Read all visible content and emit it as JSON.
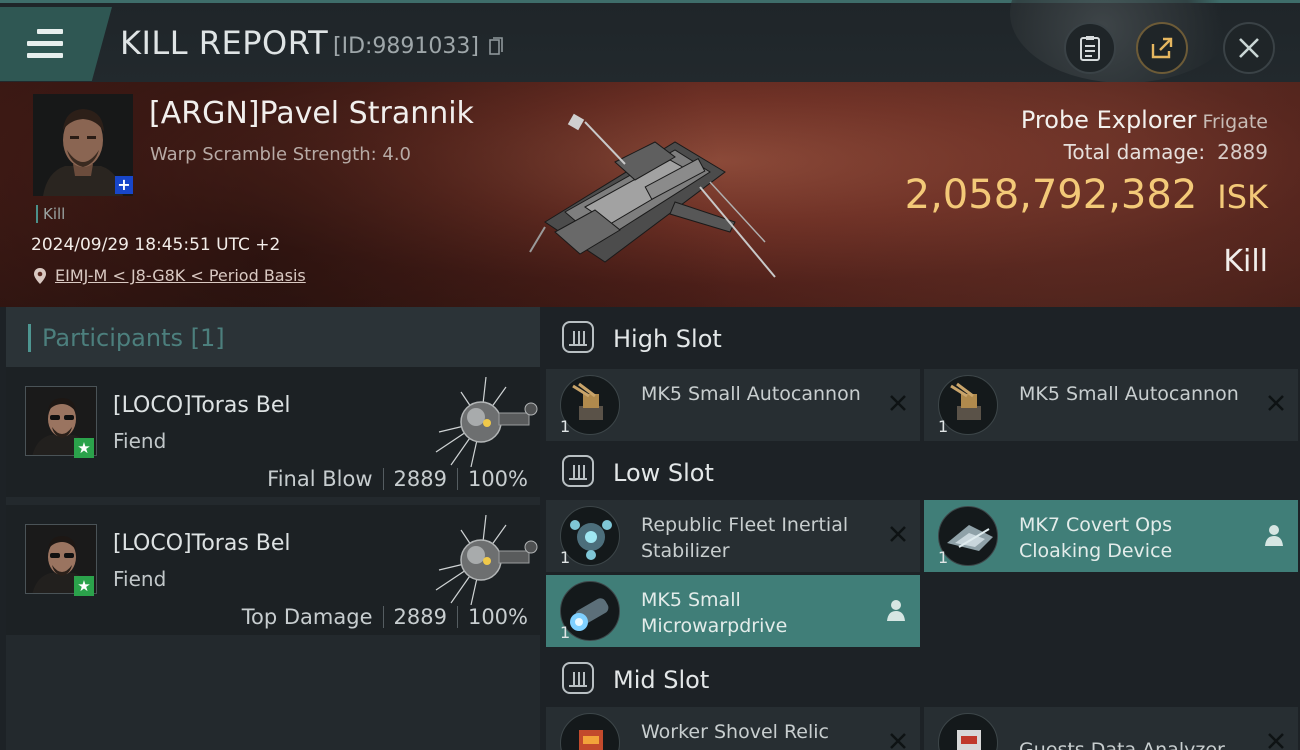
{
  "header": {
    "title": "KILL REPORT",
    "report_id": "[ID:9891033]"
  },
  "victim": {
    "name": "[ARGN]Pavel Strannik",
    "scramble": "Warp Scramble Strength: 4.0",
    "kill_tag": "Kill",
    "date": "2024/09/29 18:45:51 UTC +2",
    "location": "EIMJ-M < J8-G8K < Period Basis",
    "ship_name": "Probe Explorer",
    "ship_class": "Frigate",
    "damage_label": "Total damage:",
    "damage_value": "2889",
    "isk_value": "2,058,792,382",
    "isk_unit": "ISK",
    "kill_type": "Kill"
  },
  "participants": {
    "title": "Participants [1]",
    "items": [
      {
        "name": "[LOCO]Toras Bel",
        "ship": "Fiend",
        "role": "Final Blow",
        "damage": "2889",
        "percent": "100%"
      },
      {
        "name": "[LOCO]Toras Bel",
        "ship": "Fiend",
        "role": "Top Damage",
        "damage": "2889",
        "percent": "100%"
      }
    ]
  },
  "slots": {
    "high": {
      "title": "High Slot",
      "modules": [
        {
          "name": "MK5 Small Autocannon",
          "qty": "1",
          "status": "destroyed"
        },
        {
          "name": "MK5 Small Autocannon",
          "qty": "1",
          "status": "destroyed"
        }
      ]
    },
    "low": {
      "title": "Low Slot",
      "modules": [
        {
          "name": "Republic Fleet Inertial Stabilizer",
          "qty": "1",
          "status": "destroyed"
        },
        {
          "name": "MK7 Covert Ops Cloaking Device",
          "qty": "1",
          "status": "dropped"
        },
        {
          "name": "MK5 Small Microwarpdrive",
          "qty": "1",
          "status": "dropped"
        }
      ]
    },
    "mid": {
      "title": "Mid Slot",
      "modules": [
        {
          "name": "Worker Shovel Relic",
          "status": "destroyed"
        },
        {
          "name": "Guests Data Analyzer",
          "status": "destroyed"
        }
      ]
    }
  },
  "colors": {
    "accent": "#407e78",
    "isk": "#f3c978",
    "badge_blue": "#1846c9",
    "badge_green": "#2ba24b"
  },
  "icons": [
    "menu-icon",
    "copy-icon",
    "clipboard-icon",
    "share-icon",
    "close-icon",
    "location-pin-icon",
    "slot-icon",
    "destroyed-x-icon",
    "dropped-person-icon"
  ]
}
